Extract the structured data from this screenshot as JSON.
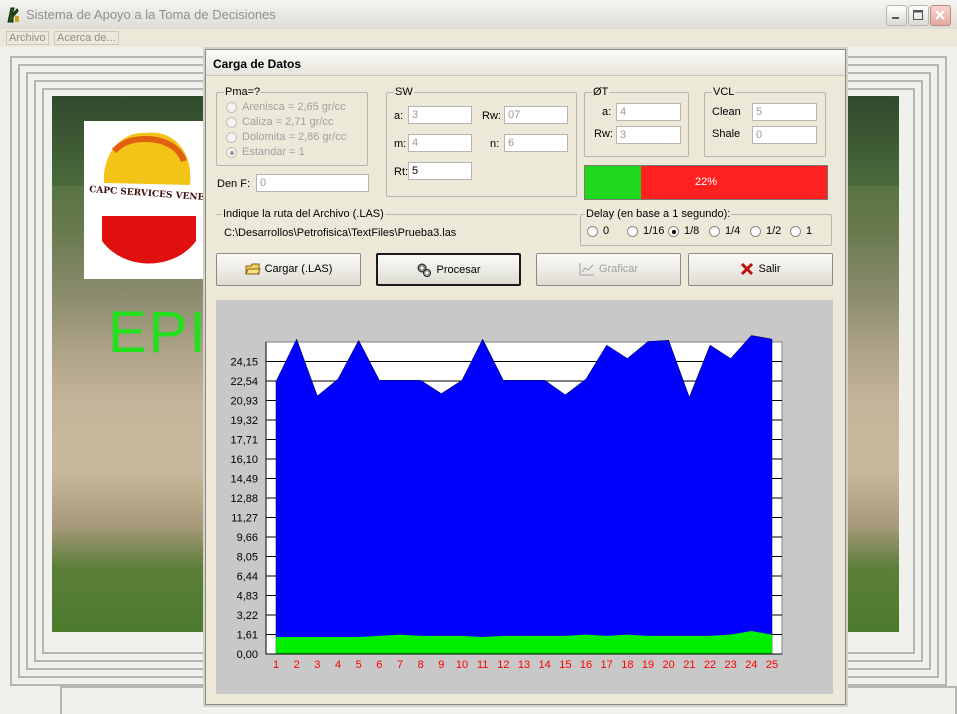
{
  "app": {
    "title": "Sistema de Apoyo a la Toma de Decisiones",
    "menu": [
      "Archivo",
      "Acerca de..."
    ],
    "background_text": "EPI",
    "logo_text": "CAPC SERVICES VENEZUELA"
  },
  "dialog": {
    "title": "Carga de Datos",
    "pma": {
      "label": "Pma=?",
      "options": [
        "Arenisca  = 2,65 gr/cc",
        "Caliza  = 2,71 gr/cc",
        "Dolomita  = 2,86 gr/cc",
        "Estandar  = 1"
      ],
      "selected_index": 3
    },
    "den_f": {
      "label": "Den F:",
      "value": "0"
    },
    "sw": {
      "label": "SW",
      "a_label": "a:",
      "a_value": "3",
      "rw_label": "Rw:",
      "rw_value": "07",
      "m_label": "m:",
      "m_value": "4",
      "n_label": "n:",
      "n_value": "6",
      "rt_label": "Rt:",
      "rt_value": "5"
    },
    "phi_t": {
      "label": "ØT",
      "a_label": "a:",
      "a_value": "4",
      "rw_label": "Rw:",
      "rw_value": "3"
    },
    "vcl": {
      "label": "VCL",
      "clean_label": "Clean",
      "clean_value": "5",
      "shale_label": "Shale",
      "shale_value": "0"
    },
    "progress": {
      "percent": 22,
      "label": "22%",
      "fill_color": "#1ed81e",
      "empty_color": "#ff2020"
    },
    "file": {
      "label": "Indique la ruta del Archivo (.LAS)",
      "path": "C:\\Desarrollos\\Petrofisica\\TextFiles\\Prueba3.las"
    },
    "delay": {
      "label": "Delay (en base a 1 segundo):",
      "options": [
        "0",
        "1/16",
        "1/8",
        "1/4",
        "1/2",
        "1"
      ],
      "selected_index": 2
    },
    "buttons": {
      "cargar": "Cargar (.LAS)",
      "procesar": "Procesar",
      "graficar": "Graficar",
      "salir": "Salir"
    }
  },
  "chart_data": {
    "type": "area",
    "x": [
      1,
      2,
      3,
      4,
      5,
      6,
      7,
      8,
      9,
      10,
      11,
      12,
      13,
      14,
      15,
      16,
      17,
      18,
      19,
      20,
      21,
      22,
      23,
      24,
      25
    ],
    "y_ticks": [
      "24,15",
      "22,54",
      "20,93",
      "19,32",
      "17,71",
      "16,10",
      "14,49",
      "12,88",
      "11,27",
      "9,66",
      "8,05",
      "6,44",
      "4,83",
      "3,22",
      "1,61",
      "0,00"
    ],
    "ylim": [
      0,
      25.76
    ],
    "grid": true,
    "colors": {
      "series_top": "#0000ff",
      "series_bottom": "#00ee00",
      "x_tick_color": "#ff0000"
    },
    "series": [
      {
        "values": [
          22.5,
          26.0,
          21.3,
          22.7,
          25.9,
          22.6,
          22.6,
          22.6,
          21.5,
          22.6,
          26.0,
          22.6,
          22.6,
          22.6,
          21.4,
          22.7,
          25.5,
          24.4,
          25.8,
          25.9,
          21.2,
          25.5,
          24.4,
          26.3,
          26.0
        ]
      },
      {
        "values": [
          1.4,
          1.4,
          1.4,
          1.4,
          1.4,
          1.5,
          1.6,
          1.5,
          1.5,
          1.5,
          1.4,
          1.5,
          1.5,
          1.5,
          1.5,
          1.6,
          1.5,
          1.6,
          1.5,
          1.5,
          1.5,
          1.5,
          1.6,
          1.9,
          1.6
        ]
      }
    ]
  }
}
